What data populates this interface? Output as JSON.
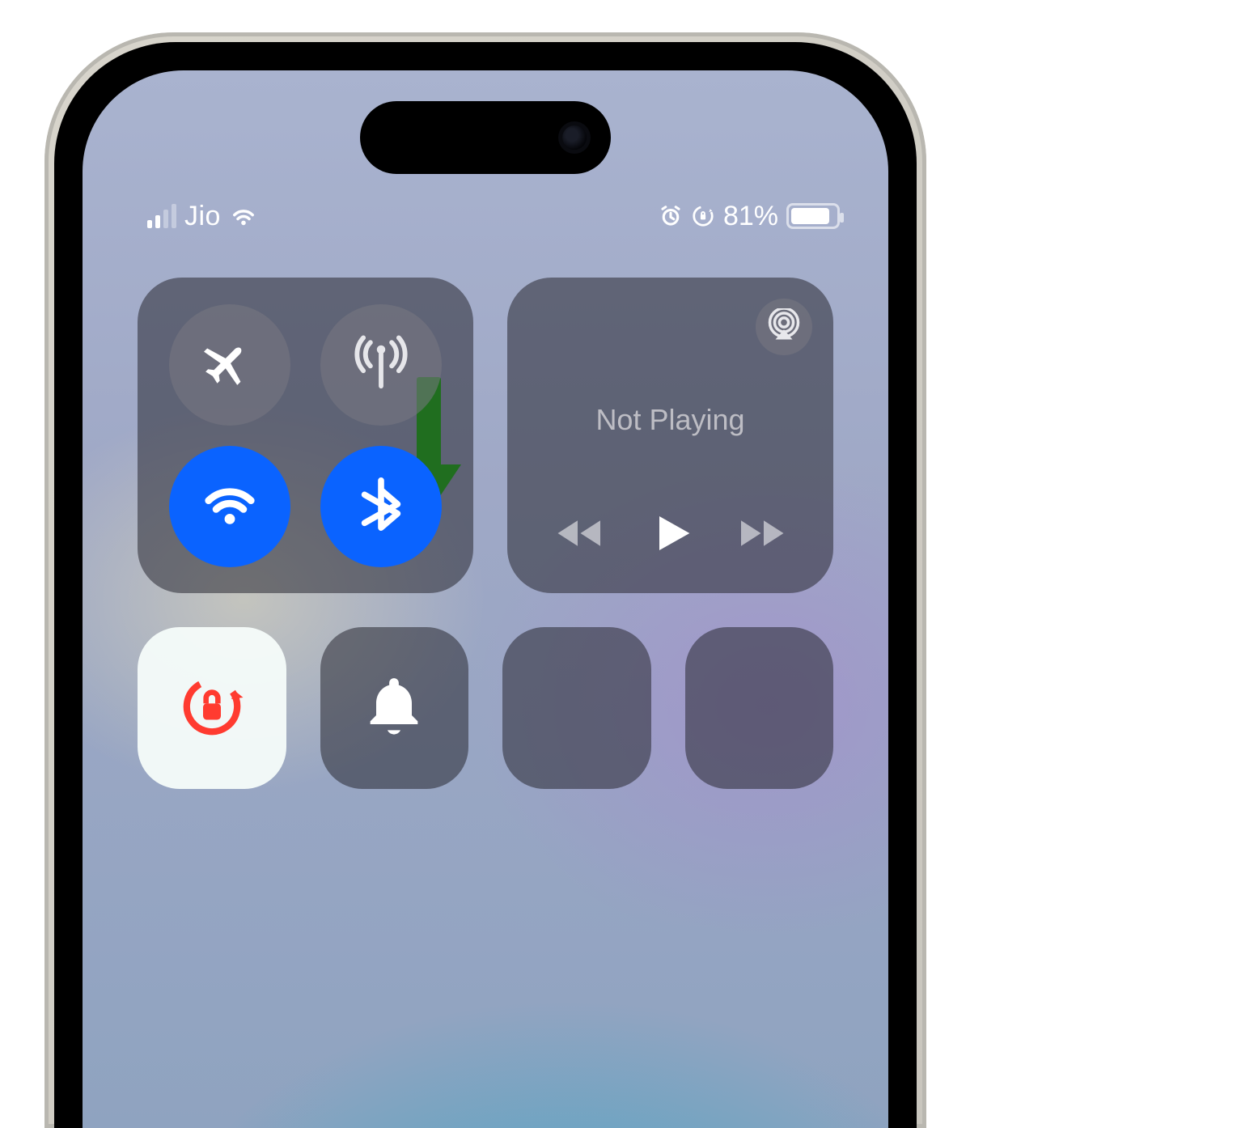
{
  "status": {
    "carrier": "Jio",
    "battery_pct": "81%",
    "signal_active_bars": 2
  },
  "media": {
    "title": "Not Playing"
  },
  "icons": {
    "airplane": "airplane-icon",
    "cellular": "cellular-antenna-icon",
    "wifi": "wifi-icon",
    "bluetooth": "bluetooth-icon",
    "airplay": "airplay-icon",
    "rewind": "rewind-icon",
    "play": "play-icon",
    "forward": "forward-icon",
    "rotation_lock": "rotation-lock-icon",
    "bell": "bell-icon",
    "alarm": "alarm-icon",
    "orientation_lock_small": "orientation-lock-small-icon"
  },
  "colors": {
    "active_blue": "#0a63ff",
    "arrow_green": "#18c40b",
    "rotation_red": "#ff3b30"
  }
}
